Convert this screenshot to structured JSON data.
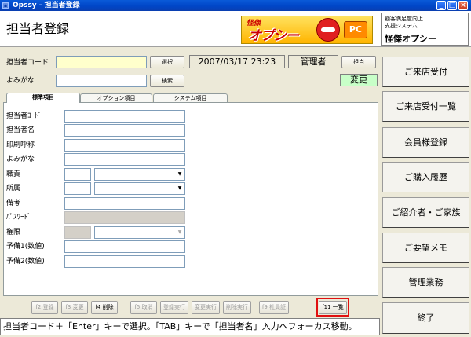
{
  "window": {
    "title": "Opssy - 担当者登録",
    "icon_name": "app-icon"
  },
  "header": {
    "page_title": "担当者登録",
    "logo_kanji": "怪傑",
    "logo_text": "オプシー",
    "logo_pc": "PC",
    "brand_sub1": "顧客満足度向上",
    "brand_sub2": "支援システム",
    "brand_main": "怪傑オプシー"
  },
  "form_top": {
    "code_label": "担当者コード",
    "code_value": "",
    "select_button": "選択",
    "datetime": "2007/03/17 23:23",
    "role": "管理者",
    "tanto_button": "担当",
    "kana_label": "よみがな",
    "kana_value": "",
    "search_button": "検索",
    "change_status": "変更"
  },
  "tabs": [
    "標準項目",
    "オプション項目",
    "システム項目"
  ],
  "fields": {
    "code": "担当者ｺｰﾄﾞ",
    "name": "担当者名",
    "print_name": "印刷呼称",
    "kana": "よみがな",
    "position": "職責",
    "department": "所属",
    "note": "備考",
    "password": "ﾊﾟｽﾜｰﾄﾞ",
    "authority": "権限",
    "spare1": "予備1(数値)",
    "spare2": "予備2(数値)"
  },
  "function_keys": [
    "f2 登録",
    "f3 変更",
    "f4 削除",
    "f5 取消",
    "登録実行",
    "変更実行",
    "削除実行",
    "f9 社員証",
    "f11 一覧"
  ],
  "status_text": "担当者コード＋「Enter」キーで選択。「TAB」キーで「担当者名」入力へフォーカス移動。",
  "nav": [
    "ご来店受付",
    "ご来店受付一覧",
    "会員様登録",
    "ご購入履歴",
    "ご紹介者・ご家族",
    "ご要望メモ",
    "管理業務",
    "終了"
  ]
}
